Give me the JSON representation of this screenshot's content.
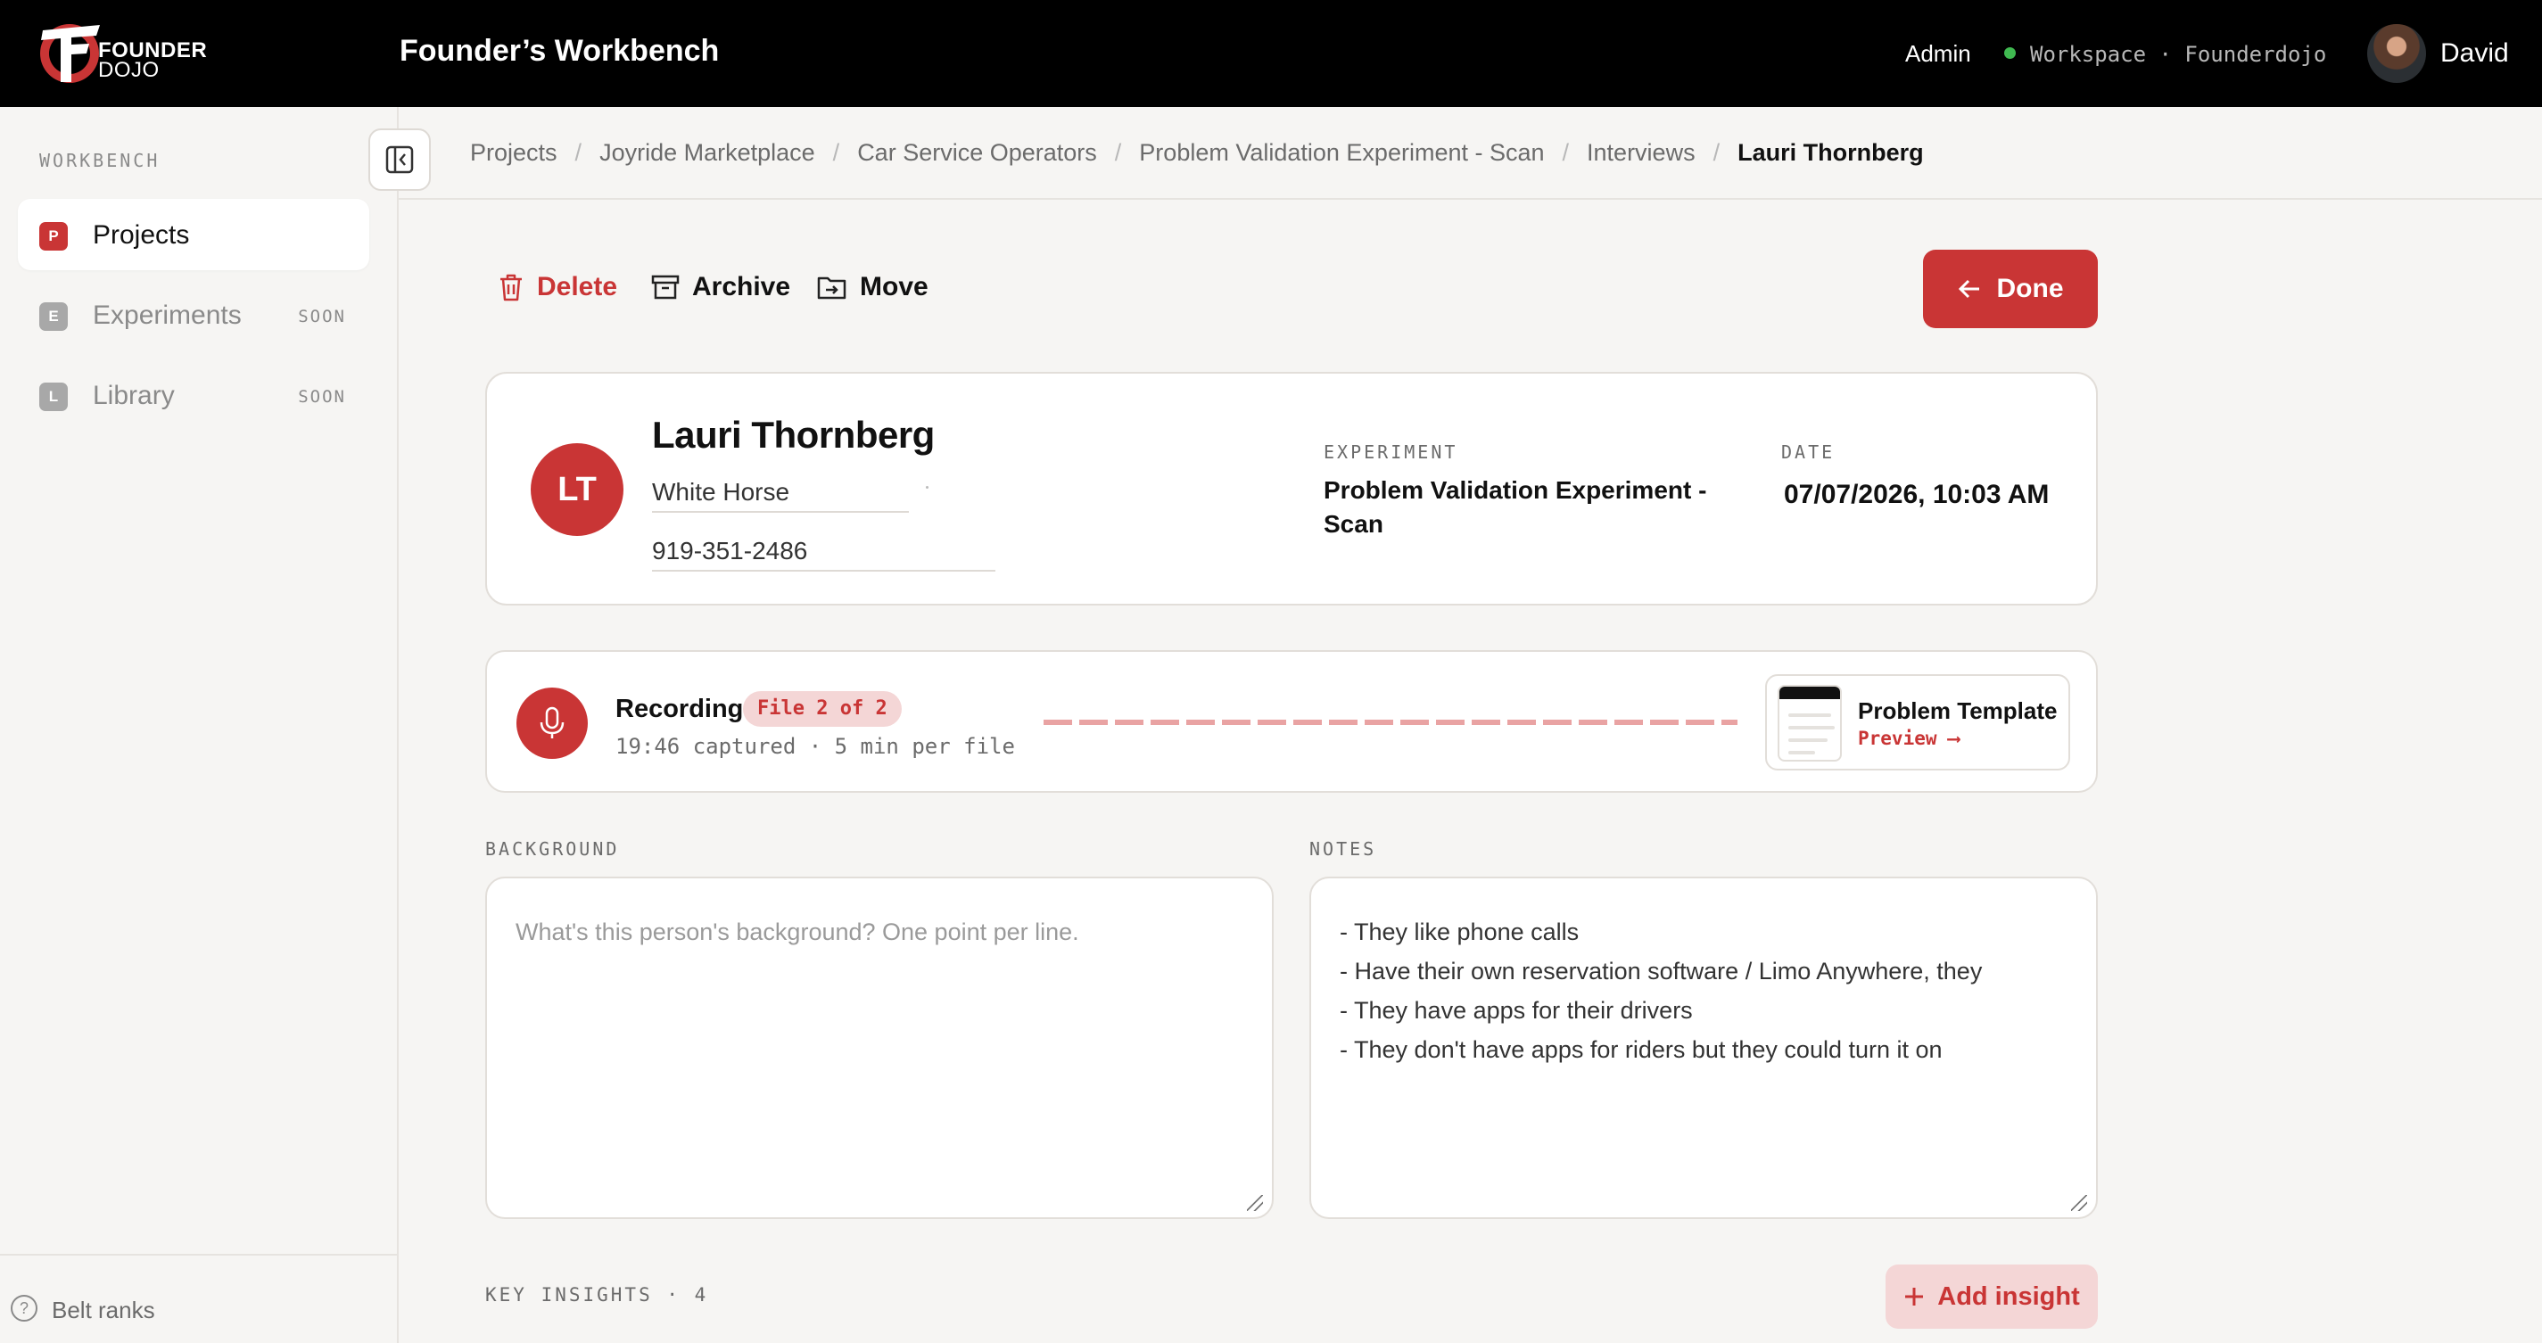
{
  "header": {
    "logo_text": "FOUNDER",
    "logo_sub": "DOJO",
    "app_title": "Founder’s Workbench",
    "admin_label": "Admin",
    "workspace_label": "Workspace · Founderdojo",
    "user_name": "David"
  },
  "sidebar": {
    "section_label": "WORKBENCH",
    "items": [
      {
        "badge": "P",
        "label": "Projects",
        "soon": "",
        "color": "#c93535"
      },
      {
        "badge": "E",
        "label": "Experiments",
        "soon": "SOON",
        "color": "#a8a8a8"
      },
      {
        "badge": "L",
        "label": "Library",
        "soon": "SOON",
        "color": "#a8a8a8"
      }
    ],
    "footer_label": "Belt ranks"
  },
  "breadcrumb": [
    "Projects",
    "Joyride Marketplace",
    "Car Service Operators",
    "Problem Validation Experiment - Scan",
    "Interviews",
    "Lauri Thornberg"
  ],
  "toolbar": {
    "delete_label": "Delete",
    "archive_label": "Archive",
    "move_label": "Move",
    "done_label": "Done"
  },
  "person": {
    "initials": "LT",
    "name": "Lauri Thornberg",
    "company": "White Horse",
    "phone": "919-351-2486",
    "experiment_label": "EXPERIMENT",
    "experiment_line1": "Problem Validation Experiment -",
    "experiment_line2": "Scan",
    "date_label": "DATE",
    "date_value": "07/07/2026, 10:03 AM"
  },
  "recording": {
    "title": "Recording",
    "file_badge": "File 2 of 2",
    "subtitle": "19:46 captured · 5 min per file",
    "template_title": "Problem Template",
    "template_link": "Preview ⟶"
  },
  "background": {
    "label": "BACKGROUND",
    "placeholder": "What's this person's background? One point per line.",
    "value": ""
  },
  "notes": {
    "label": "NOTES",
    "value": "- They like phone calls\n- Have their own reservation software / Limo Anywhere, they\n- They have apps for their drivers\n- They don't have apps for riders but they could turn it on"
  },
  "insights": {
    "label": "KEY INSIGHTS · 4",
    "add_label": "Add insight"
  },
  "colors": {
    "accent": "#c93535",
    "accent_soft": "#f4d6d6",
    "topbar": "#000000",
    "status_dot": "#3fb950"
  }
}
